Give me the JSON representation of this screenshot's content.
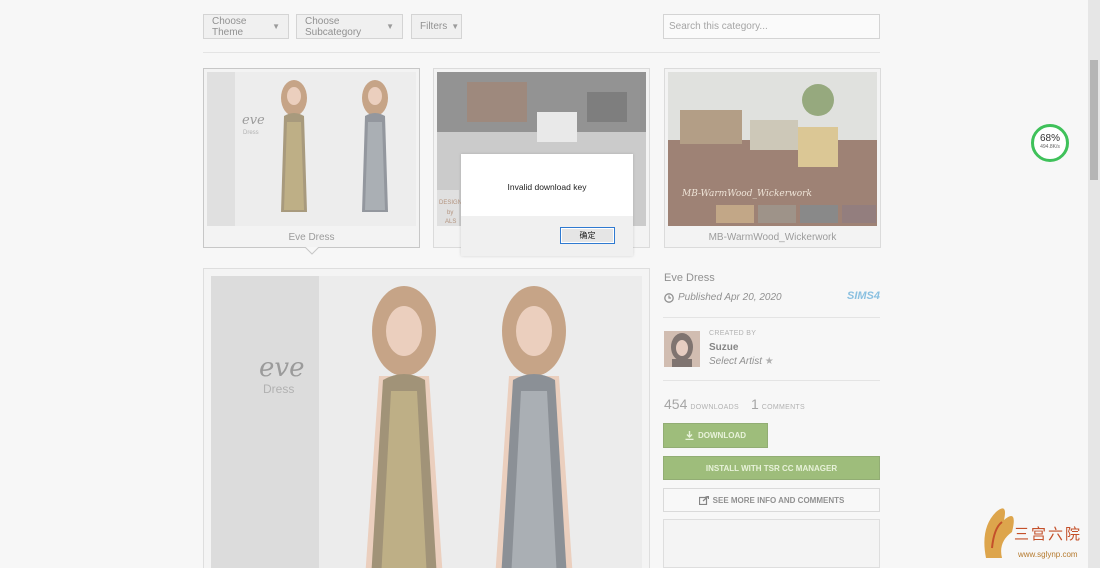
{
  "toolbar": {
    "theme_label": "Choose Theme",
    "subcategory_label": "Choose Subcategory",
    "filters_label": "Filters",
    "search_placeholder": "Search this category..."
  },
  "thumbnails": [
    {
      "caption": "Eve Dress",
      "img_title": "eve",
      "img_sub": "Dress"
    },
    {
      "caption": "",
      "img_text_1": "DESIGN",
      "img_text_2": "by",
      "img_text_3": "ALS"
    },
    {
      "caption": "MB-WarmWood_Wickerwork",
      "img_text": "MB-WarmWood_Wickerwork"
    }
  ],
  "preview": {
    "img_title": "eve",
    "img_sub": "Dress"
  },
  "item": {
    "title": "Eve Dress",
    "published": "Published Apr 20, 2020",
    "game_logo": "SIMS4",
    "created_by_label": "CREATED BY",
    "artist": "Suzue",
    "artist_badge": "Select Artist",
    "downloads_count": "454",
    "downloads_label": "DOWNLOADS",
    "comments_count": "1",
    "comments_label": "COMMENTS",
    "download_button": "DOWNLOAD",
    "tsr_button": "INSTALL WITH TSR CC MANAGER",
    "more_button": "SEE MORE INFO AND COMMENTS"
  },
  "dialog": {
    "message": "Invalid download key",
    "ok_label": "确定"
  },
  "speed_widget": {
    "percent": "68%",
    "rate": "494.8K/s"
  },
  "watermark": {
    "text": "三宫六院",
    "url": "www.sglynp.com"
  },
  "colors": {
    "accent_green": "#6a9a35",
    "speed_ring": "#3fc15a",
    "dialog_focus": "#2f7ad1"
  }
}
